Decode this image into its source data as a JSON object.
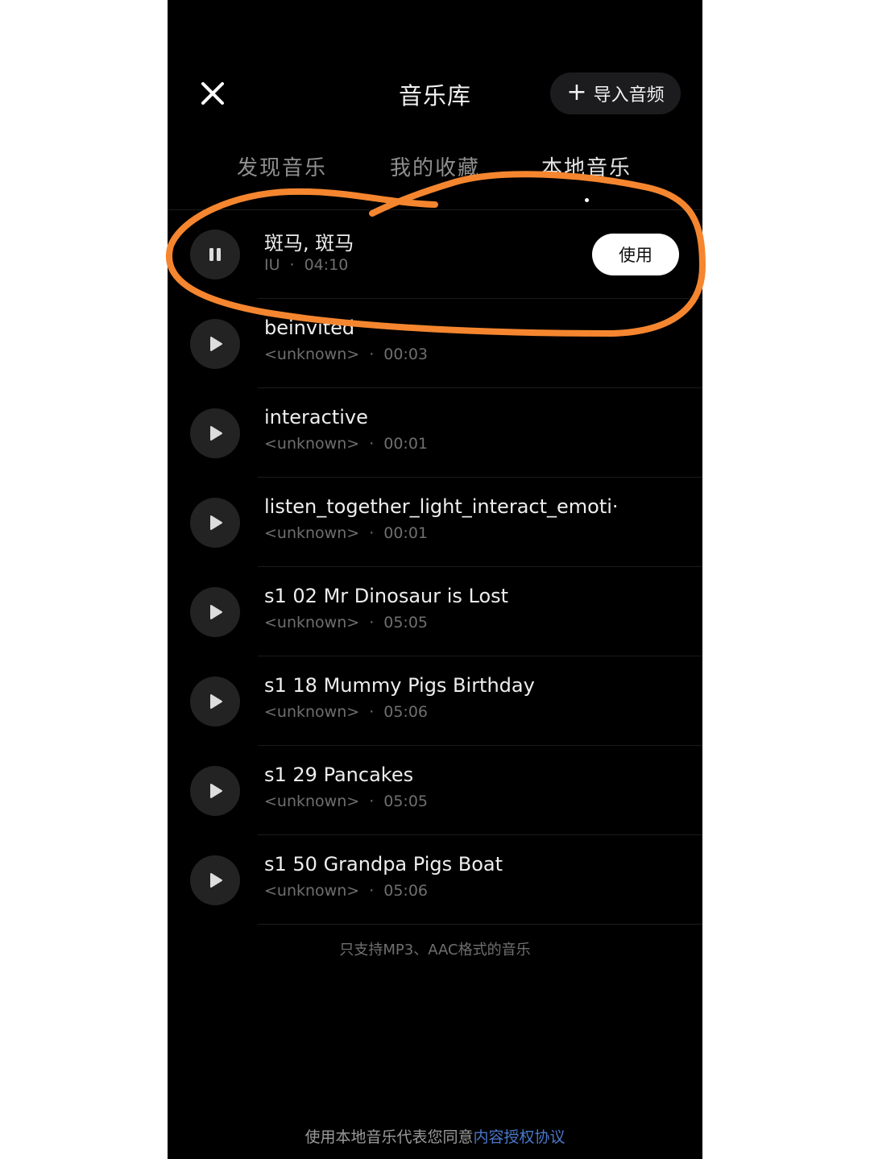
{
  "header": {
    "close_icon": "close-icon",
    "title": "音乐库",
    "import_button": {
      "icon": "plus-icon",
      "label": "导入音频"
    }
  },
  "tabs": [
    {
      "label": "发现音乐",
      "active": false
    },
    {
      "label": "我的收藏",
      "active": false
    },
    {
      "label": "本地音乐",
      "active": true
    }
  ],
  "tracks": [
    {
      "title": "斑马, 斑马",
      "artist": "IU",
      "separator": "·",
      "duration": "04:10",
      "state": "playing",
      "icon": "pause-icon",
      "action_label": "使用"
    },
    {
      "title": "beinvited",
      "artist": "<unknown>",
      "separator": "·",
      "duration": "00:03",
      "state": "stopped",
      "icon": "play-icon"
    },
    {
      "title": "interactive",
      "artist": "<unknown>",
      "separator": "·",
      "duration": "00:01",
      "state": "stopped",
      "icon": "play-icon"
    },
    {
      "title": "listen_together_light_interact_emoti···",
      "artist": "<unknown>",
      "separator": "·",
      "duration": "00:01",
      "state": "stopped",
      "icon": "play-icon"
    },
    {
      "title": "s1 02 Mr Dinosaur is Lost",
      "artist": "<unknown>",
      "separator": "·",
      "duration": "05:05",
      "state": "stopped",
      "icon": "play-icon"
    },
    {
      "title": "s1 18 Mummy Pigs Birthday",
      "artist": "<unknown>",
      "separator": "·",
      "duration": "05:06",
      "state": "stopped",
      "icon": "play-icon"
    },
    {
      "title": "s1 29 Pancakes",
      "artist": "<unknown>",
      "separator": "·",
      "duration": "05:05",
      "state": "stopped",
      "icon": "play-icon"
    },
    {
      "title": "s1 50 Grandpa Pigs Boat",
      "artist": "<unknown>",
      "separator": "·",
      "duration": "05:06",
      "state": "stopped",
      "icon": "play-icon"
    }
  ],
  "footer_note": "只支持MP3、AAC格式的音乐",
  "agreement": {
    "prefix": "使用本地音乐代表您同意",
    "link": "内容授权协议"
  },
  "colors": {
    "background": "#000000",
    "annotation_stroke": "#f5862f",
    "link": "#4a78c8"
  }
}
